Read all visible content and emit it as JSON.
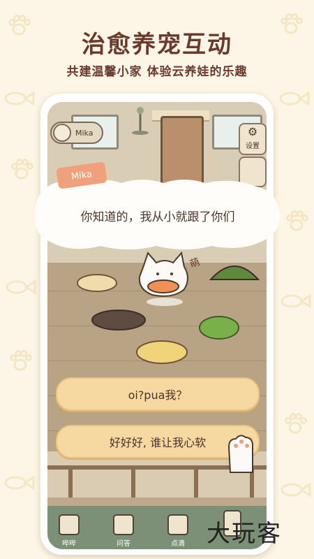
{
  "promo": {
    "headline": "治愈养宠互动",
    "subline": "共建温馨小家 体验云养娃的乐趣"
  },
  "game": {
    "profile_name": "Mika",
    "settings_label": "设置",
    "dialog": {
      "speaker": "Mika",
      "text": "你知道的，我从小就跟了你们"
    },
    "cat_sticker": "萌",
    "choices": [
      {
        "label": "oi?pua我？"
      },
      {
        "label": "好好好, 谁让我心软"
      }
    ],
    "tabs": [
      {
        "label": "哔哔",
        "icon": "cat-face-icon"
      },
      {
        "label": "问答",
        "icon": "note-icon"
      },
      {
        "label": "点滴",
        "icon": "heart-card-icon"
      },
      {
        "label": "",
        "icon": "phone-icon"
      }
    ]
  },
  "watermark": "大玩客",
  "colors": {
    "headline": "#6b3a2c",
    "accent": "#f0a07a",
    "choice": "#f6d9a0",
    "tabbar": "#7b9076"
  }
}
